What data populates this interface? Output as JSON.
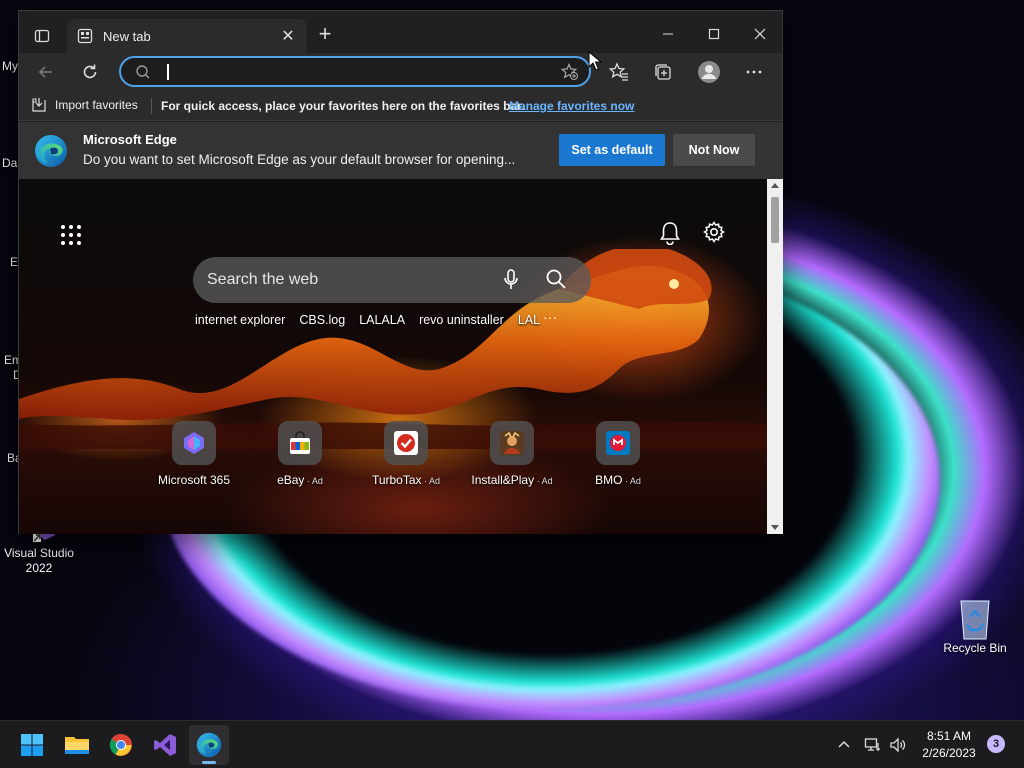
{
  "desktop": {
    "icons": [
      {
        "label": "Visual Studio 2022"
      },
      {
        "label": "Recycle Bin"
      }
    ],
    "edge_labels": [
      "My",
      "Da",
      "E",
      "Em",
      "D",
      "Ba"
    ]
  },
  "browser": {
    "tab": {
      "title": "New tab",
      "close_glyph": "✕"
    },
    "new_tab_glyph": "+",
    "address_bar": {
      "value": "",
      "placeholder": ""
    },
    "favorites_bar": {
      "import_label": "Import favorites",
      "hint": "For quick access, place your favorites here on the favorites bar.",
      "manage_link": "Manage favorites now"
    },
    "default_banner": {
      "title": "Microsoft Edge",
      "message": "Do you want to set Microsoft Edge as your default browser for opening...",
      "primary_button": "Set as default",
      "secondary_button": "Not Now"
    },
    "new_tab_page": {
      "search_placeholder": "Search the web",
      "quick_links": [
        "internet explorer",
        "CBS.log",
        "LALALA",
        "revo uninstaller",
        "LAL"
      ],
      "more_glyph": "···",
      "tiles": [
        {
          "label": "Microsoft 365",
          "ad": ""
        },
        {
          "label": "eBay",
          "ad": " · Ad"
        },
        {
          "label": "TurboTax",
          "ad": " · Ad"
        },
        {
          "label": "Install&Play",
          "ad": " · Ad"
        },
        {
          "label": "BMO",
          "ad": " · Ad"
        }
      ]
    }
  },
  "taskbar": {
    "apps": [
      "start-icon",
      "file-explorer-icon",
      "chrome-icon",
      "visual-studio-icon",
      "edge-icon"
    ],
    "clock": {
      "time": "8:51 AM",
      "date": "2/26/2023"
    },
    "notification_count": "3"
  },
  "colors": {
    "accent": "#1b78d0",
    "link": "#6cb6ff",
    "address_focus": "#4ea0e8",
    "taskbar": "#1c1c1e"
  }
}
